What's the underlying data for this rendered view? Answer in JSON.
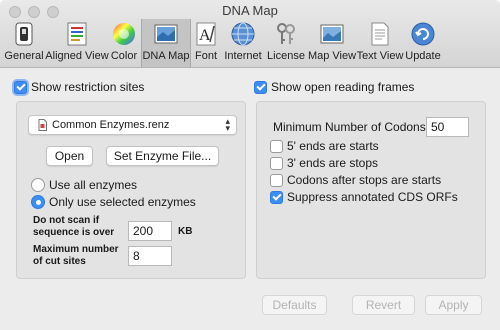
{
  "window": {
    "title": "DNA Map"
  },
  "toolbar": {
    "items": [
      {
        "label": "General",
        "icon": "general-switch-icon"
      },
      {
        "label": "Aligned View",
        "icon": "aligned-view-icon"
      },
      {
        "label": "Color",
        "icon": "color-wheel-icon"
      },
      {
        "label": "DNA Map",
        "icon": "dna-map-icon"
      },
      {
        "label": "Font",
        "icon": "font-icon"
      },
      {
        "label": "Internet",
        "icon": "globe-icon"
      },
      {
        "label": "License",
        "icon": "keys-icon"
      },
      {
        "label": "Map View",
        "icon": "map-view-icon"
      },
      {
        "label": "Text View",
        "icon": "text-view-icon"
      },
      {
        "label": "Update",
        "icon": "update-icon"
      }
    ],
    "active": "DNA Map"
  },
  "restriction": {
    "show_label": "Show restriction sites",
    "show_checked": true,
    "enzyme_file": "Common Enzymes.renz",
    "open_label": "Open",
    "set_file_label": "Set Enzyme File...",
    "use_all_label": "Use all enzymes",
    "use_selected_label": "Only use selected enzymes",
    "selected_option": "Only use selected enzymes",
    "no_scan_line1": "Do not scan if",
    "no_scan_line2": "sequence is over",
    "no_scan_value": "200",
    "no_scan_unit": "KB",
    "max_cut_line1": "Maximum number",
    "max_cut_line2": "of cut sites",
    "max_cut_value": "8"
  },
  "orf": {
    "show_label": "Show open reading frames",
    "show_checked": true,
    "min_codons_label": "Minimum Number of Codons:",
    "min_codons_value": "50",
    "options": [
      {
        "label": "5' ends are starts",
        "checked": false
      },
      {
        "label": "3' ends are stops",
        "checked": false
      },
      {
        "label": "Codons after stops are starts",
        "checked": false
      },
      {
        "label": "Suppress annotated CDS ORFs",
        "checked": true
      }
    ]
  },
  "footer": {
    "defaults_label": "Defaults",
    "revert_label": "Revert",
    "apply_label": "Apply"
  },
  "colors": {
    "accent": "#3d8df5",
    "panel": "#e3e3e3",
    "window": "#ececec"
  }
}
